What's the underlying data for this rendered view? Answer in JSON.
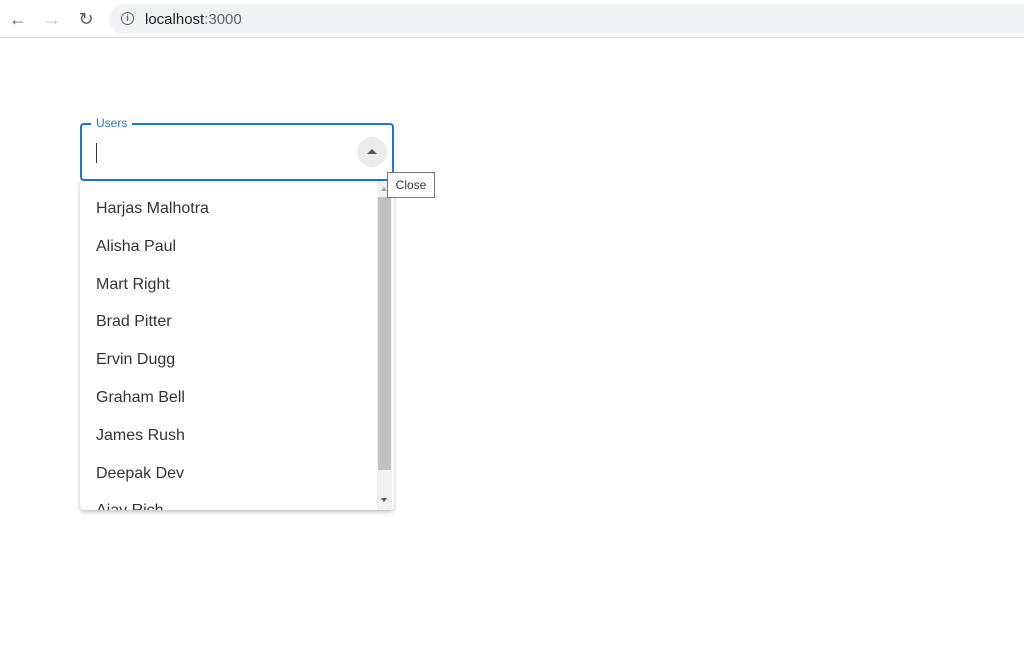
{
  "browser": {
    "back_icon": "arrow-left",
    "forward_icon": "arrow-right",
    "reload_icon": "reload",
    "url_host": "localhost",
    "url_port": ":3000"
  },
  "autocomplete": {
    "label": "Users",
    "value": "",
    "open": true,
    "accent_color": "#1976d2",
    "toggle_tooltip": "Close",
    "options": [
      "Harjas Malhotra",
      "Alisha Paul",
      "Mart Right",
      "Brad Pitter",
      "Ervin Dugg",
      "Graham Bell",
      "James Rush",
      "Deepak Dev",
      "Ajay Rich"
    ]
  }
}
